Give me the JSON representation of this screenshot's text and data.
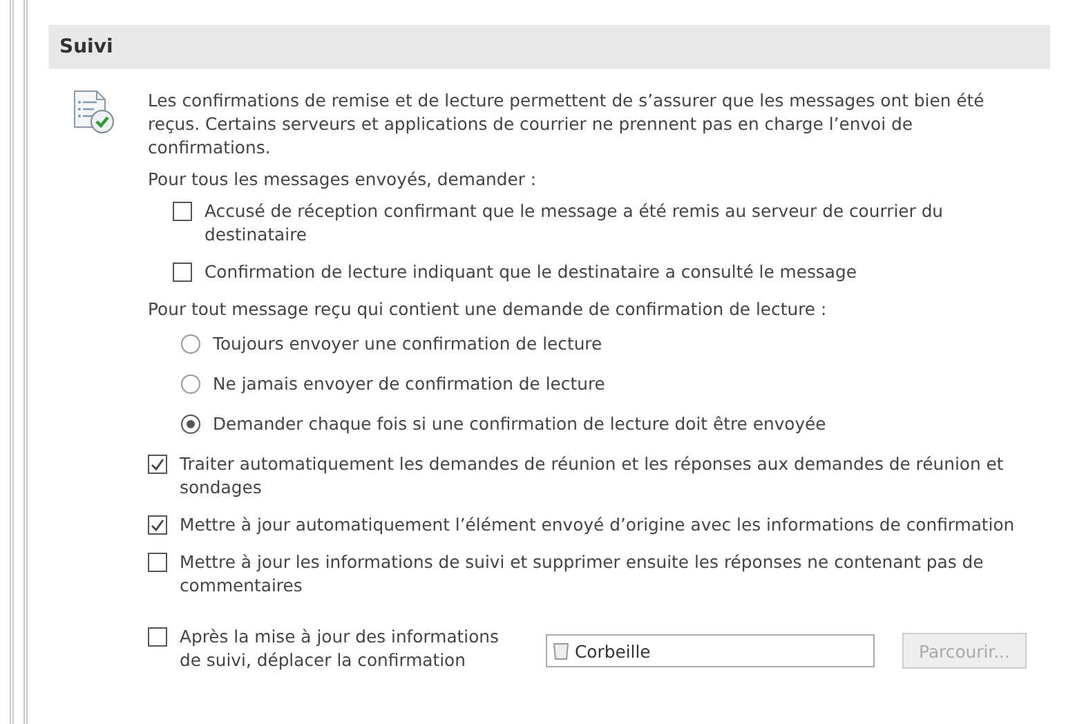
{
  "section": {
    "title": "Suivi"
  },
  "intro": "Les confirmations de remise et de lecture permettent de s’assurer que les messages ont bien été reçus. Certains serveurs et applications de courrier ne prennent pas en charge l’envoi de confirmations.",
  "sent_group": {
    "label": "Pour tous les messages envoyés, demander :",
    "options": [
      {
        "label": "Accusé de réception confirmant que le message a été remis au serveur de courrier du destinataire",
        "checked": false
      },
      {
        "label": "Confirmation de lecture indiquant que le destinataire a consulté le message",
        "checked": false
      }
    ]
  },
  "received_group": {
    "label": "Pour tout message reçu qui contient une demande de confirmation de lecture :",
    "options": [
      {
        "label": "Toujours envoyer une confirmation de lecture",
        "selected": false
      },
      {
        "label": "Ne jamais envoyer de confirmation de lecture",
        "selected": false
      },
      {
        "label": "Demander chaque fois si une confirmation de lecture doit être envoyée",
        "selected": true
      }
    ]
  },
  "options": [
    {
      "label": "Traiter automatiquement les demandes de réunion et les réponses aux demandes de réunion et sondages",
      "checked": true
    },
    {
      "label": "Mettre à jour automatiquement l’élément envoyé d’origine avec les informations de confirmation",
      "checked": true
    },
    {
      "label": "Mettre à jour les informations de suivi et supprimer ensuite les réponses ne contenant pas de commentaires",
      "checked": false
    }
  ],
  "move_option": {
    "label": "Après la mise à jour des informations de suivi, déplacer la confirmation",
    "checked": false,
    "folder": "Corbeille",
    "browse": {
      "label": "Parcourir...",
      "disabled": true
    }
  }
}
